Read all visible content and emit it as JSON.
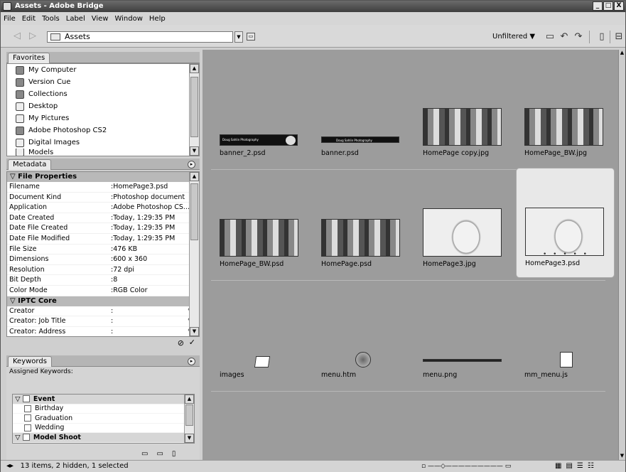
{
  "window": {
    "title": "Assets - Adobe Bridge",
    "minimize": "_",
    "restore": "□",
    "close": "X"
  },
  "menu": [
    "File",
    "Edit",
    "Tools",
    "Label",
    "View",
    "Window",
    "Help"
  ],
  "toolbar": {
    "path": "Assets",
    "filter_label": "Unfiltered ▼"
  },
  "favorites": {
    "tab": "Favorites",
    "items": [
      "My Computer",
      "Version Cue",
      "Collections",
      "Desktop",
      "My Pictures",
      "Adobe Photoshop CS2",
      "Digital Images",
      "Models"
    ]
  },
  "metadata": {
    "tab": "Metadata",
    "file_section": "File Properties",
    "file_rows": [
      {
        "k": "Filename",
        "v": "HomePage3.psd"
      },
      {
        "k": "Document Kind",
        "v": "Photoshop document"
      },
      {
        "k": "Application",
        "v": "Adobe Photoshop CS..."
      },
      {
        "k": "Date Created",
        "v": "Today, 1:29:35 PM"
      },
      {
        "k": "Date File Created",
        "v": "Today, 1:29:35 PM"
      },
      {
        "k": "Date File Modified",
        "v": "Today, 1:29:35 PM"
      },
      {
        "k": "File Size",
        "v": "476 KB"
      },
      {
        "k": "Dimensions",
        "v": "600 x 360"
      },
      {
        "k": "Resolution",
        "v": "72 dpi"
      },
      {
        "k": "Bit Depth",
        "v": "8"
      },
      {
        "k": "Color Mode",
        "v": "RGB Color"
      }
    ],
    "iptc_section": "IPTC Core",
    "iptc_rows": [
      {
        "k": "Creator",
        "v": ""
      },
      {
        "k": "Creator: Job Title",
        "v": ""
      },
      {
        "k": "Creator: Address",
        "v": ""
      }
    ]
  },
  "keywords": {
    "tab": "Keywords",
    "assigned_label": "Assigned Keywords:",
    "groups": [
      {
        "name": "Event",
        "items": [
          "Birthday",
          "Graduation",
          "Wedding"
        ]
      },
      {
        "name": "Model Shoot",
        "items": []
      }
    ]
  },
  "content": {
    "rows": [
      [
        {
          "name": "banner_2.psd",
          "kind": "banner-dark"
        },
        {
          "name": "banner.psd",
          "kind": "banner-thin"
        },
        {
          "name": "HomePage copy.jpg",
          "kind": "collage"
        },
        {
          "name": "HomePage_BW.jpg",
          "kind": "collage"
        }
      ],
      [
        {
          "name": "HomePage_BW.psd",
          "kind": "collage"
        },
        {
          "name": "HomePage.psd",
          "kind": "collage"
        },
        {
          "name": "HomePage3.jpg",
          "kind": "face"
        },
        {
          "name": "HomePage3.psd",
          "kind": "face",
          "selected": true
        }
      ],
      [
        {
          "name": "images",
          "kind": "folder"
        },
        {
          "name": "menu.htm",
          "kind": "htm"
        },
        {
          "name": "menu.png",
          "kind": "strip"
        },
        {
          "name": "mm_menu.js",
          "kind": "js"
        }
      ]
    ],
    "banner_text": "Doug Sahlin Photography"
  },
  "status": {
    "text": "13 items, 2 hidden, 1 selected"
  }
}
